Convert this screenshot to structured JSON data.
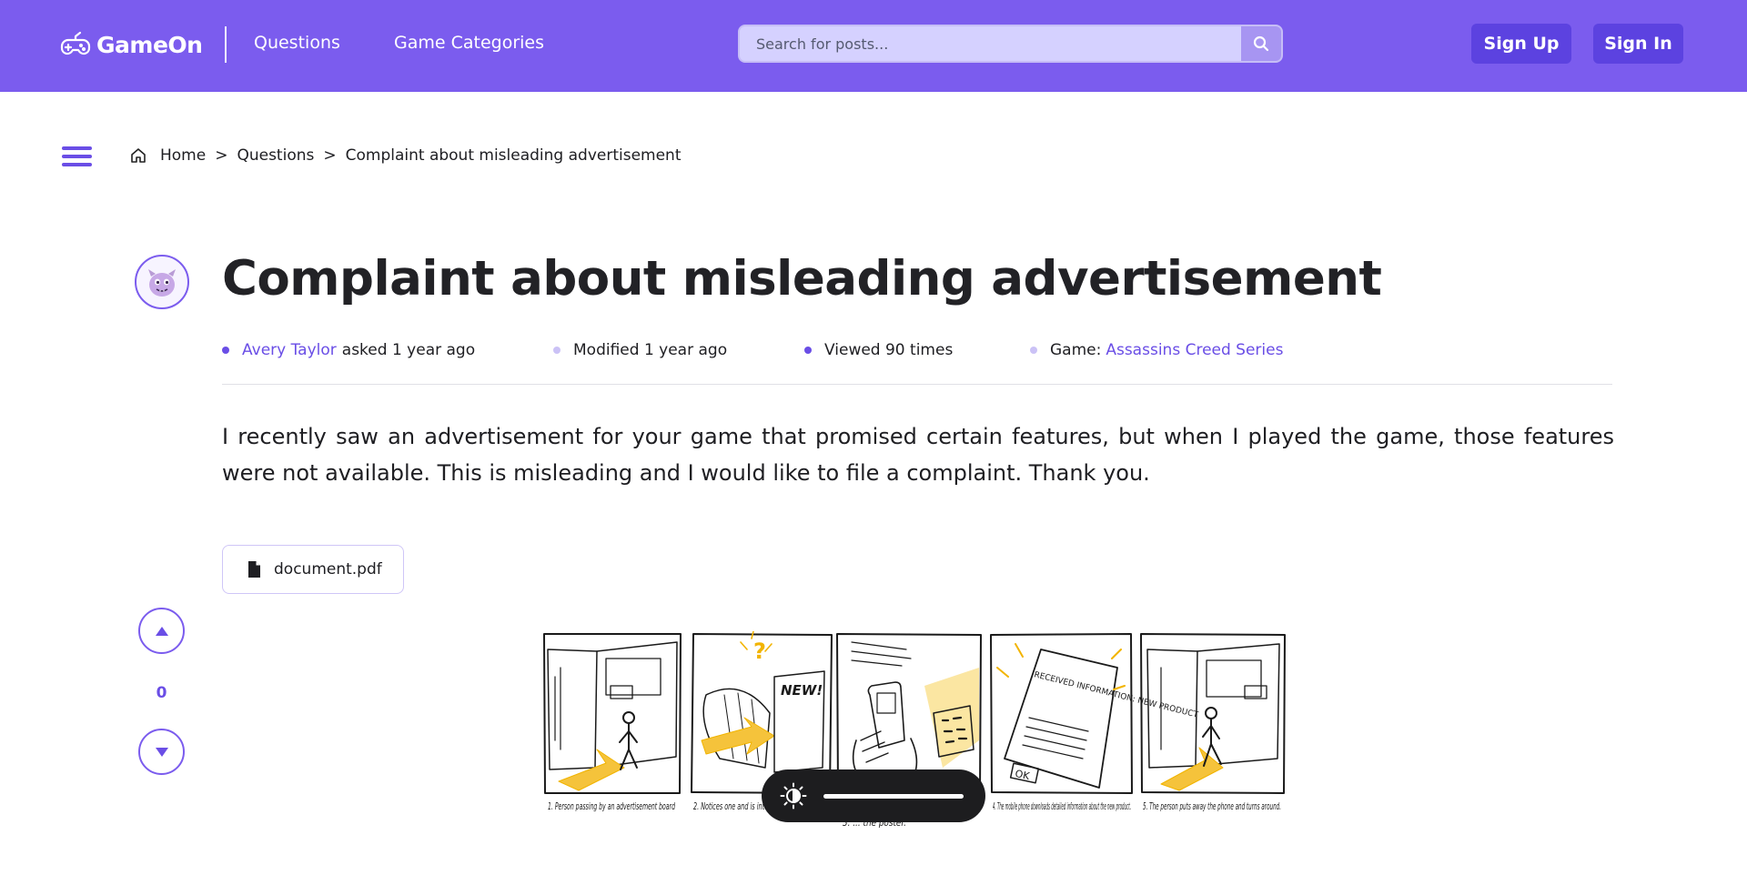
{
  "header": {
    "logo_text": "GameOn",
    "nav": {
      "questions": "Questions",
      "categories": "Game Categories"
    },
    "search_placeholder": "Search for posts...",
    "sign_up": "Sign Up",
    "sign_in": "Sign In"
  },
  "breadcrumb": {
    "home": "Home",
    "separator": ">",
    "questions": "Questions",
    "current": "Complaint about misleading advertisement"
  },
  "post": {
    "title": "Complaint about misleading advertisement",
    "author": "Avery Taylor",
    "asked": "asked 1 year ago",
    "modified": "Modified 1 year ago",
    "viewed": "Viewed 90 times",
    "game_label": "Game:",
    "game": "Assassins Creed Series",
    "body": "I recently saw an advertisement for your game that promised certain features, but when I played the game, those features were not available. This is misleading and I would like to file a complaint. Thank you.",
    "attachment": "document.pdf",
    "votes": "0"
  },
  "storyboard": {
    "captions": [
      "1. Person passing by an advertisement board",
      "2. Notices one and is interested in information",
      "3. ... the poster.",
      "4. The mobile phone downloads detailed information about the new product.",
      "5. The person puts away the phone and turns around."
    ],
    "poster_text": "NEW!",
    "screen_text": "RECEIVED INFORMATION: NEW PRODUCT",
    "ok_text": "OK"
  },
  "colors": {
    "brand": "#7b5cee",
    "button": "#5c42e0",
    "link": "#6a4ee6",
    "dot_dark": "#6a4ee6",
    "dot_light": "#cbc2f6"
  },
  "icons": {
    "logo": "gamepad-icon",
    "search": "search-icon",
    "menu": "hamburger-menu-icon",
    "home": "home-icon",
    "attachment": "file-icon",
    "upvote": "triangle-up-icon",
    "downvote": "triangle-down-icon",
    "brightness": "brightness-icon"
  },
  "brightness_level": 1.0
}
